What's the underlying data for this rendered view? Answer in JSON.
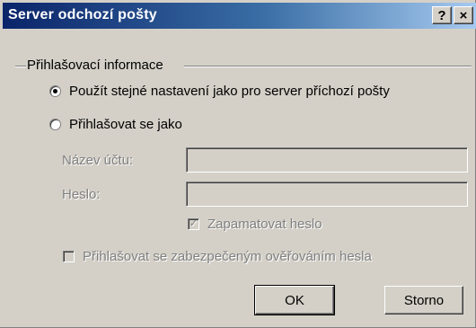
{
  "window": {
    "title": "Server odchozí pošty",
    "help_label": "?",
    "close_label": "×"
  },
  "group": {
    "label": "Přihlašovací informace"
  },
  "radios": {
    "same_settings": {
      "label": "Použít stejné nastavení jako pro server příchozí pošty",
      "checked": true
    },
    "login_as": {
      "label": "Přihlašovat se jako",
      "checked": false
    }
  },
  "fields": {
    "account_name_label": "Název účtu:",
    "account_name_value": "",
    "password_label": "Heslo:",
    "password_value": ""
  },
  "checkboxes": {
    "remember_password": {
      "label": "Zapamatovat heslo",
      "checked": true
    },
    "spa": {
      "label": "Přihlašovat se zabezpečeným ověřováním hesla",
      "checked": false
    }
  },
  "buttons": {
    "ok": "OK",
    "cancel": "Storno"
  }
}
